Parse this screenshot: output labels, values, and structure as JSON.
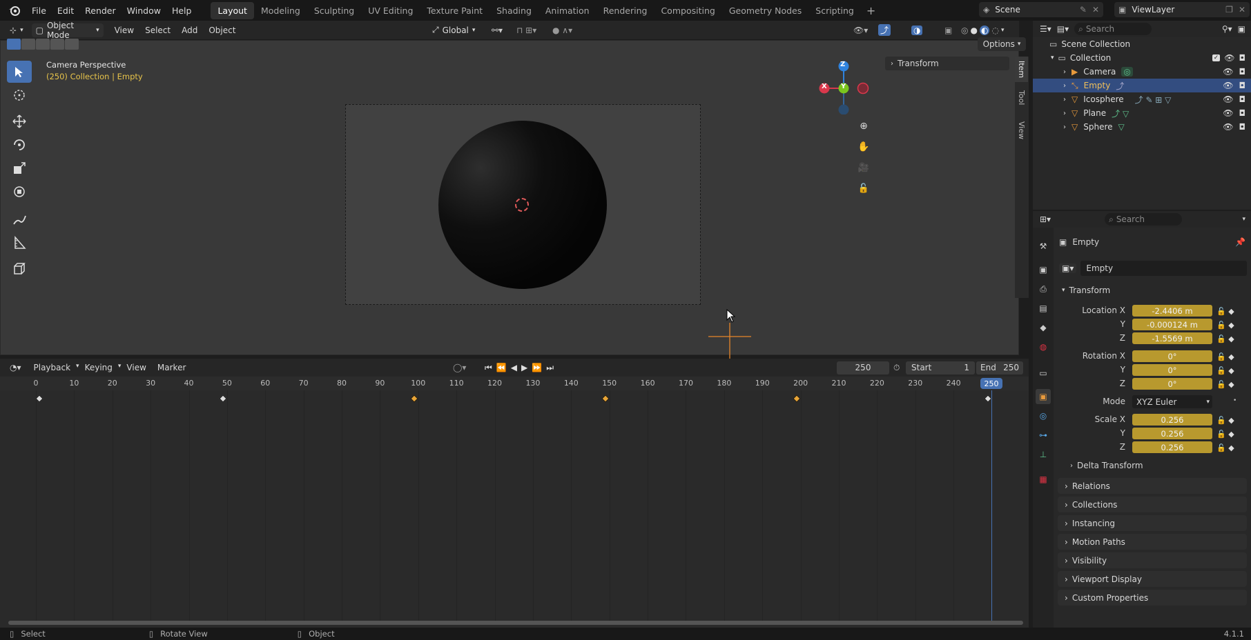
{
  "app": {
    "version": "4.1.1"
  },
  "menubar": {
    "items": [
      "File",
      "Edit",
      "Render",
      "Window",
      "Help"
    ]
  },
  "workspaces": [
    "Layout",
    "Modeling",
    "Sculpting",
    "UV Editing",
    "Texture Paint",
    "Shading",
    "Animation",
    "Rendering",
    "Compositing",
    "Geometry Nodes",
    "Scripting"
  ],
  "active_workspace": "Layout",
  "scene": {
    "name": "Scene",
    "view_layer": "ViewLayer"
  },
  "viewport_header": {
    "mode": "Object Mode",
    "menus": [
      "View",
      "Select",
      "Add",
      "Object"
    ],
    "orientation": "Global",
    "options_label": "Options"
  },
  "viewport": {
    "camera_label": "Camera Perspective",
    "context_label": "(250) Collection | Empty",
    "npanel_header": "Transform",
    "side_tabs": [
      "Item",
      "Tool",
      "View"
    ],
    "gizmo_axes": {
      "x": "X",
      "y": "Y",
      "z": "Z"
    }
  },
  "outliner": {
    "search_placeholder": "Search",
    "root": "Scene Collection",
    "collection": "Collection",
    "items": [
      {
        "name": "Camera",
        "selected": false
      },
      {
        "name": "Empty",
        "selected": true
      },
      {
        "name": "Icosphere",
        "selected": false
      },
      {
        "name": "Plane",
        "selected": false
      },
      {
        "name": "Sphere",
        "selected": false
      }
    ]
  },
  "properties": {
    "search_placeholder": "Search",
    "object_name": "Empty",
    "object_field": "Empty",
    "transform_header": "Transform",
    "location_label": "Location X",
    "rotation_label": "Rotation X",
    "scale_label": "Scale X",
    "y_label": "Y",
    "z_label": "Z",
    "location": [
      "-2.4406 m",
      "-0.000124 m",
      "-1.5569 m"
    ],
    "rotation": [
      "0°",
      "0°",
      "0°"
    ],
    "mode_label": "Mode",
    "mode_value": "XYZ Euler",
    "scale": [
      "0.256",
      "0.256",
      "0.256"
    ],
    "delta_transform": "Delta Transform",
    "panels": [
      "Relations",
      "Collections",
      "Instancing",
      "Motion Paths",
      "Visibility",
      "Viewport Display",
      "Custom Properties"
    ]
  },
  "timeline": {
    "menus": [
      "Playback",
      "Keying",
      "View",
      "Marker"
    ],
    "current_frame": "250",
    "start_label": "Start",
    "start": "1",
    "end_label": "End",
    "end": "250",
    "ticks": [
      "0",
      "10",
      "20",
      "30",
      "40",
      "50",
      "60",
      "70",
      "80",
      "90",
      "100",
      "110",
      "120",
      "130",
      "140",
      "150",
      "160",
      "170",
      "180",
      "190",
      "200",
      "210",
      "220",
      "230",
      "240"
    ],
    "playhead_label": "250",
    "keyframes": [
      1,
      50,
      100,
      150,
      200,
      250
    ]
  },
  "statusbar": {
    "select": "Select",
    "rotate": "Rotate View",
    "object": "Object",
    "version": "4.1.1"
  },
  "colors": {
    "accent": "#4772b3",
    "keyframe": "#e8a537",
    "field": "#b8992e",
    "axis_x": "#d9384c",
    "axis_y": "#7bc61e",
    "axis_z": "#2f83de"
  }
}
